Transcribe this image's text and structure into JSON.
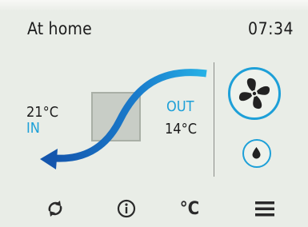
{
  "header": {
    "mode_label": "At home",
    "time": "07:34"
  },
  "temperatures": {
    "indoor_value": "21°C",
    "indoor_label": "IN",
    "outdoor_label": "OUT",
    "outdoor_value": "14°C"
  },
  "controls": {
    "fan_icon": "fan-icon",
    "humidity_icon": "water-drop-icon"
  },
  "bottom_bar": {
    "items": [
      {
        "icon": "auto-rotate-icon"
      },
      {
        "icon": "info-icon"
      },
      {
        "label": "°C"
      },
      {
        "icon": "menu-icon"
      }
    ]
  },
  "colors": {
    "accent": "#1ea0d8",
    "arrow_dark": "#1565b8",
    "background": "#e9ede7"
  }
}
